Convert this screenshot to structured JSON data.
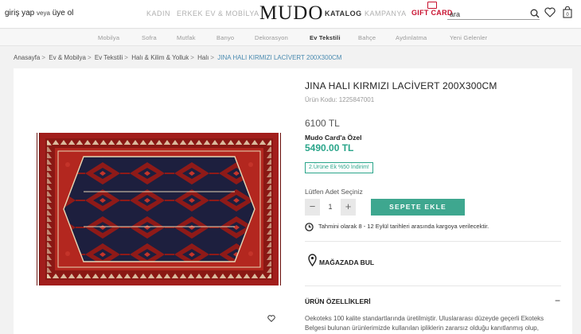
{
  "header": {
    "login": "giriş yap",
    "login_sep": "veya",
    "register": "üye ol",
    "nav": [
      "KADIN",
      "ERKEK",
      "EV & MOBİLYA"
    ],
    "logo": "MUDO",
    "katalog": "KATALOG",
    "kampanya": "KAMPANYA",
    "gift": "GIFT CARD",
    "search_value": "ara",
    "icons": [
      "search-icon",
      "heart-icon",
      "bag-icon"
    ]
  },
  "categories": [
    "Mobilya",
    "Sofra",
    "Mutfak",
    "Banyo",
    "Dekorasyon",
    "Ev Tekstili",
    "Bahçe",
    "Aydınlatma",
    "Yeni Gelenler"
  ],
  "active_category": "Ev Tekstili",
  "breadcrumb": [
    "Anasayfa",
    "Ev & Mobilya",
    "Ev Tekstili",
    "Halı & Kilim & Yolluk",
    "Halı",
    "JINA HALI KIRMIZI LACİVERT 200X300CM"
  ],
  "product": {
    "title": "JINA HALI KIRMIZI LACİVERT 200X300CM",
    "code": "Ürün Kodu: 1225847001",
    "price": "6100 TL",
    "card_label": "Mudo Card'a Özel",
    "card_price": "5490.00 TL",
    "promo": "2.Ürüne Ek %50 İndirim!",
    "qty_label": "Lütfen Adet Seçiniz",
    "qty": "1",
    "minus": "−",
    "plus": "+",
    "add_to_cart": "SEPETE EKLE",
    "delivery": "Tahmini olarak 8 - 12 Eylül tarihleri arasında kargoya verilecektir.",
    "store": "MAĞAZADA BUL",
    "features_title": "ÜRÜN ÖZELLİKLERİ",
    "features_toggle": "−",
    "description_1": "Oekoteks 100 kalite standartlarında üretilmiştir. Uluslararası düzeyde geçerli Ekoteks",
    "description_2": "Belgesi bulunan ürünlerimizde kullanılan ipliklerin zararsız olduğu kanıtlanmış olup,"
  },
  "colors": {
    "accent": "#3ea78f",
    "card_price": "#2aa58a",
    "gift": "#c8102e",
    "breadcrumb_active": "#4a8bb0",
    "rug_red": "#a21e1c",
    "rug_navy": "#1d1f3e"
  }
}
